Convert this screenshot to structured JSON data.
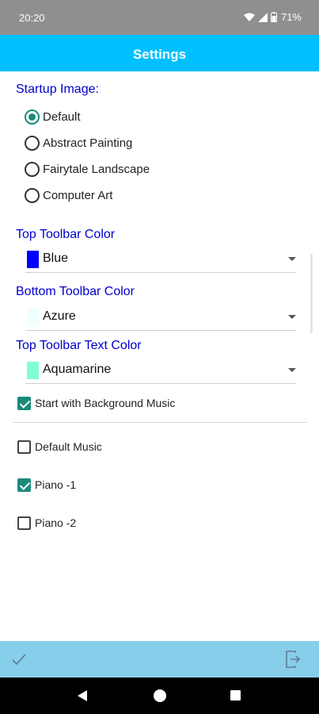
{
  "status_bar": {
    "time": "20:20",
    "battery": "71%"
  },
  "app_bar": {
    "title": "Settings"
  },
  "startup_image": {
    "label": "Startup Image:",
    "options": [
      "Default",
      "Abstract Painting",
      "Fairytale Landscape",
      "Computer Art"
    ],
    "selected": "Default"
  },
  "top_toolbar_color": {
    "label": "Top Toolbar Color",
    "value": "Blue",
    "swatch": "#0000ff"
  },
  "bottom_toolbar_color": {
    "label": "Bottom Toolbar Color",
    "value": "Azure",
    "swatch": "#f0ffff"
  },
  "top_toolbar_text_color": {
    "label": "Top Toolbar Text Color",
    "value": "Aquamarine",
    "swatch": "#7fffd4"
  },
  "background_music": {
    "label": "Start with Background Music",
    "checked": true
  },
  "music_options": [
    {
      "label": "Default Music",
      "checked": false
    },
    {
      "label": "Piano -1",
      "checked": true
    },
    {
      "label": "Piano -2",
      "checked": false
    }
  ],
  "colors": {
    "app_bar": "#00bfff",
    "bottom_bar": "#87ceeb",
    "accent": "#1a8a7a",
    "section_label": "#0000cc"
  }
}
